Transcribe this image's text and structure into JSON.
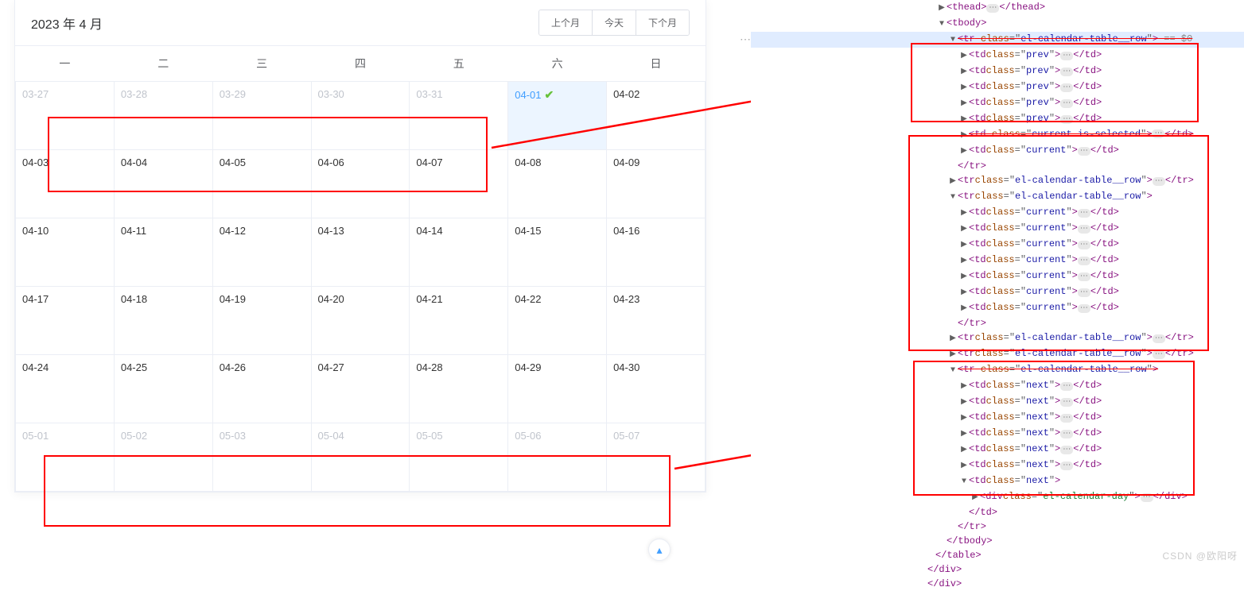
{
  "calendar": {
    "title": "2023 年 4 月",
    "buttons": {
      "prev": "上个月",
      "today": "今天",
      "next": "下个月"
    },
    "weekdays": [
      "一",
      "二",
      "三",
      "四",
      "五",
      "六",
      "日"
    ],
    "rows": [
      [
        {
          "d": "03-27",
          "cls": "prev"
        },
        {
          "d": "03-28",
          "cls": "prev"
        },
        {
          "d": "03-29",
          "cls": "prev"
        },
        {
          "d": "03-30",
          "cls": "prev"
        },
        {
          "d": "03-31",
          "cls": "prev"
        },
        {
          "d": "04-01",
          "cls": "current is-selected",
          "check": true
        },
        {
          "d": "04-02",
          "cls": "current"
        }
      ],
      [
        {
          "d": "04-03",
          "cls": "current"
        },
        {
          "d": "04-04",
          "cls": "current"
        },
        {
          "d": "04-05",
          "cls": "current"
        },
        {
          "d": "04-06",
          "cls": "current"
        },
        {
          "d": "04-07",
          "cls": "current"
        },
        {
          "d": "04-08",
          "cls": "current"
        },
        {
          "d": "04-09",
          "cls": "current"
        }
      ],
      [
        {
          "d": "04-10",
          "cls": "current"
        },
        {
          "d": "04-11",
          "cls": "current"
        },
        {
          "d": "04-12",
          "cls": "current"
        },
        {
          "d": "04-13",
          "cls": "current"
        },
        {
          "d": "04-14",
          "cls": "current"
        },
        {
          "d": "04-15",
          "cls": "current"
        },
        {
          "d": "04-16",
          "cls": "current"
        }
      ],
      [
        {
          "d": "04-17",
          "cls": "current"
        },
        {
          "d": "04-18",
          "cls": "current"
        },
        {
          "d": "04-19",
          "cls": "current"
        },
        {
          "d": "04-20",
          "cls": "current"
        },
        {
          "d": "04-21",
          "cls": "current"
        },
        {
          "d": "04-22",
          "cls": "current"
        },
        {
          "d": "04-23",
          "cls": "current"
        }
      ],
      [
        {
          "d": "04-24",
          "cls": "current"
        },
        {
          "d": "04-25",
          "cls": "current"
        },
        {
          "d": "04-26",
          "cls": "current"
        },
        {
          "d": "04-27",
          "cls": "current"
        },
        {
          "d": "04-28",
          "cls": "current"
        },
        {
          "d": "04-29",
          "cls": "current"
        },
        {
          "d": "04-30",
          "cls": "current"
        }
      ],
      [
        {
          "d": "05-01",
          "cls": "next"
        },
        {
          "d": "05-02",
          "cls": "next"
        },
        {
          "d": "05-03",
          "cls": "next"
        },
        {
          "d": "05-04",
          "cls": "next"
        },
        {
          "d": "05-05",
          "cls": "next"
        },
        {
          "d": "05-06",
          "cls": "next"
        },
        {
          "d": "05-07",
          "cls": "next"
        }
      ]
    ]
  },
  "dom": {
    "lines": [
      {
        "pad": 2,
        "caret": "right",
        "open": "thead",
        "collapsed": true,
        "close": "thead"
      },
      {
        "pad": 2,
        "caret": "down",
        "open": "tbody"
      },
      {
        "pad": 3,
        "caret": "down",
        "open": "tr",
        "cls": "el-calendar-table__row",
        "hl": true,
        "after": " == $0",
        "strike": true
      },
      {
        "pad": 4,
        "caret": "right",
        "open": "td",
        "cls": "prev",
        "collapsed": true,
        "close": "td"
      },
      {
        "pad": 4,
        "caret": "right",
        "open": "td",
        "cls": "prev",
        "collapsed": true,
        "close": "td"
      },
      {
        "pad": 4,
        "caret": "right",
        "open": "td",
        "cls": "prev",
        "collapsed": true,
        "close": "td"
      },
      {
        "pad": 4,
        "caret": "right",
        "open": "td",
        "cls": "prev",
        "collapsed": true,
        "close": "td"
      },
      {
        "pad": 4,
        "caret": "right",
        "open": "td",
        "cls": "prev",
        "collapsed": true,
        "close": "td"
      },
      {
        "pad": 4,
        "caret": "right",
        "open": "td",
        "cls": "current is-selected",
        "collapsed": true,
        "close": "td",
        "strike": true
      },
      {
        "pad": 4,
        "caret": "right",
        "open": "td",
        "cls": "current",
        "collapsed": true,
        "close": "td"
      },
      {
        "pad": 3,
        "closeonly": "tr"
      },
      {
        "pad": 3,
        "caret": "right",
        "open": "tr",
        "cls": "el-calendar-table__row",
        "collapsed": true,
        "close": "tr"
      },
      {
        "pad": 3,
        "caret": "down",
        "open": "tr",
        "cls": "el-calendar-table__row"
      },
      {
        "pad": 4,
        "caret": "right",
        "open": "td",
        "cls": "current",
        "collapsed": true,
        "close": "td"
      },
      {
        "pad": 4,
        "caret": "right",
        "open": "td",
        "cls": "current",
        "collapsed": true,
        "close": "td"
      },
      {
        "pad": 4,
        "caret": "right",
        "open": "td",
        "cls": "current",
        "collapsed": true,
        "close": "td"
      },
      {
        "pad": 4,
        "caret": "right",
        "open": "td",
        "cls": "current",
        "collapsed": true,
        "close": "td"
      },
      {
        "pad": 4,
        "caret": "right",
        "open": "td",
        "cls": "current",
        "collapsed": true,
        "close": "td"
      },
      {
        "pad": 4,
        "caret": "right",
        "open": "td",
        "cls": "current",
        "collapsed": true,
        "close": "td"
      },
      {
        "pad": 4,
        "caret": "right",
        "open": "td",
        "cls": "current",
        "collapsed": true,
        "close": "td"
      },
      {
        "pad": 3,
        "closeonly": "tr"
      },
      {
        "pad": 3,
        "caret": "right",
        "open": "tr",
        "cls": "el-calendar-table__row",
        "collapsed": true,
        "close": "tr"
      },
      {
        "pad": 3,
        "caret": "right",
        "open": "tr",
        "cls": "el-calendar-table__row",
        "collapsed": true,
        "close": "tr"
      },
      {
        "pad": 3,
        "caret": "down",
        "open": "tr",
        "cls": "el-calendar-table__row",
        "strike": true
      },
      {
        "pad": 4,
        "caret": "right",
        "open": "td",
        "cls": "next",
        "collapsed": true,
        "close": "td"
      },
      {
        "pad": 4,
        "caret": "right",
        "open": "td",
        "cls": "next",
        "collapsed": true,
        "close": "td"
      },
      {
        "pad": 4,
        "caret": "right",
        "open": "td",
        "cls": "next",
        "collapsed": true,
        "close": "td"
      },
      {
        "pad": 4,
        "caret": "right",
        "open": "td",
        "cls": "next",
        "collapsed": true,
        "close": "td"
      },
      {
        "pad": 4,
        "caret": "right",
        "open": "td",
        "cls": "next",
        "collapsed": true,
        "close": "td"
      },
      {
        "pad": 4,
        "caret": "right",
        "open": "td",
        "cls": "next",
        "collapsed": true,
        "close": "td"
      },
      {
        "pad": 4,
        "caret": "down",
        "open": "td",
        "cls": "next"
      },
      {
        "pad": 5,
        "caret": "right",
        "open": "div",
        "cls": "el-calendar-day",
        "green": true,
        "collapsed": true,
        "close": "div"
      },
      {
        "pad": 4,
        "closeonly": "td"
      },
      {
        "pad": 3,
        "closeonly": "tr"
      },
      {
        "pad": 2,
        "closeonly": "tbody"
      },
      {
        "pad": 1,
        "closeonly": "table"
      },
      {
        "pad": 0,
        "closeonly": "div"
      },
      {
        "pad": 0,
        "closeonly": "div",
        "dim": true
      }
    ]
  },
  "watermark": "CSDN @欧阳呀"
}
